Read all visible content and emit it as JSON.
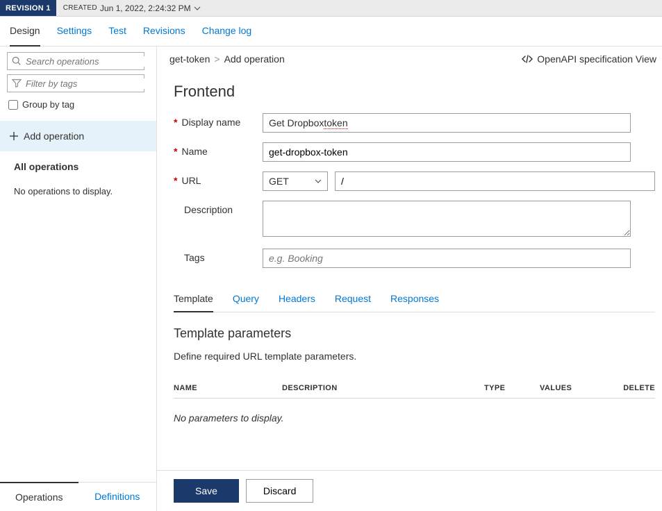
{
  "revision": {
    "label": "REVISION 1",
    "createdLabel": "CREATED",
    "created": "Jun 1, 2022, 2:24:32 PM"
  },
  "mainTabs": [
    "Design",
    "Settings",
    "Test",
    "Revisions",
    "Change log"
  ],
  "activeMainTab": "Design",
  "sidebar": {
    "searchPlaceholder": "Search operations",
    "filterPlaceholder": "Filter by tags",
    "groupByTag": "Group by tag",
    "addOperation": "Add operation",
    "allOps": "All operations",
    "empty": "No operations to display.",
    "bottomTabs": [
      "Operations",
      "Definitions"
    ],
    "activeBottomTab": "Operations"
  },
  "breadcrumb": {
    "parent": "get-token",
    "current": "Add operation"
  },
  "openapi": "OpenAPI specification View",
  "form": {
    "section": "Frontend",
    "labels": {
      "displayName": "Display name",
      "name": "Name",
      "url": "URL",
      "description": "Description",
      "tags": "Tags"
    },
    "values": {
      "displayName": "Get Dropbox token",
      "name": "get-dropbox-token",
      "method": "GET",
      "urlPath": "/",
      "description": "",
      "tags": ""
    },
    "placeholders": {
      "tags": "e.g. Booking"
    }
  },
  "subTabs": [
    "Template",
    "Query",
    "Headers",
    "Request",
    "Responses"
  ],
  "activeSubTab": "Template",
  "params": {
    "title": "Template parameters",
    "desc": "Define required URL template parameters.",
    "columns": {
      "name": "NAME",
      "description": "DESCRIPTION",
      "type": "TYPE",
      "values": "VALUES",
      "delete": "DELETE"
    },
    "empty": "No parameters to display."
  },
  "buttons": {
    "save": "Save",
    "discard": "Discard"
  }
}
